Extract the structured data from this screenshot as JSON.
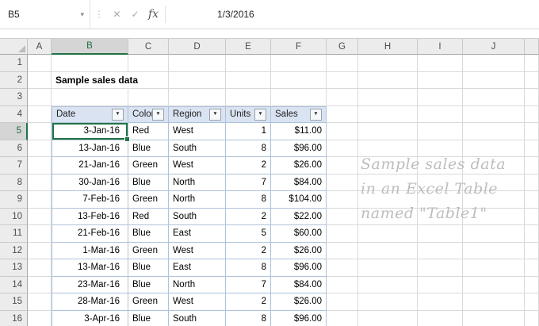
{
  "formula_bar": {
    "name_box_value": "B5",
    "cancel_label": "✕",
    "enter_label": "✓",
    "fx_label": "fx",
    "formula_value": "1/3/2016",
    "dots": "⋮",
    "dropdown_arrow": "▾"
  },
  "sheet": {
    "column_headers": [
      "A",
      "B",
      "C",
      "D",
      "E",
      "F",
      "G",
      "H",
      "I",
      "J"
    ],
    "row_headers": [
      "1",
      "2",
      "3",
      "4",
      "5",
      "6",
      "7",
      "8",
      "9",
      "10",
      "11",
      "12",
      "13",
      "14",
      "15",
      "16"
    ],
    "selected_cell": "B5",
    "title_text": "Sample sales data"
  },
  "table": {
    "name": "Table1",
    "headers": [
      "Date",
      "Color",
      "Region",
      "Units",
      "Sales"
    ],
    "filter_icon": "▼",
    "rows": [
      [
        "3-Jan-16",
        "Red",
        "West",
        "1",
        "$11.00"
      ],
      [
        "13-Jan-16",
        "Blue",
        "South",
        "8",
        "$96.00"
      ],
      [
        "21-Jan-16",
        "Green",
        "West",
        "2",
        "$26.00"
      ],
      [
        "30-Jan-16",
        "Blue",
        "North",
        "7",
        "$84.00"
      ],
      [
        "7-Feb-16",
        "Green",
        "North",
        "8",
        "$104.00"
      ],
      [
        "13-Feb-16",
        "Red",
        "South",
        "2",
        "$22.00"
      ],
      [
        "21-Feb-16",
        "Blue",
        "East",
        "5",
        "$60.00"
      ],
      [
        "1-Mar-16",
        "Green",
        "West",
        "2",
        "$26.00"
      ],
      [
        "13-Mar-16",
        "Blue",
        "East",
        "8",
        "$96.00"
      ],
      [
        "23-Mar-16",
        "Blue",
        "North",
        "7",
        "$84.00"
      ],
      [
        "28-Mar-16",
        "Green",
        "West",
        "2",
        "$26.00"
      ],
      [
        "3-Apr-16",
        "Blue",
        "South",
        "8",
        "$96.00"
      ]
    ]
  },
  "watermark": {
    "lines": [
      "Sample sales data",
      "in an Excel Table",
      "named \"Table1\""
    ]
  },
  "colors": {
    "selection_green": "#217346",
    "table_header_fill": "#dae3f1",
    "table_border": "#aec3db",
    "gridline": "#dadada",
    "header_fill": "#ececec",
    "watermark_gray": "#bdbdbd"
  }
}
